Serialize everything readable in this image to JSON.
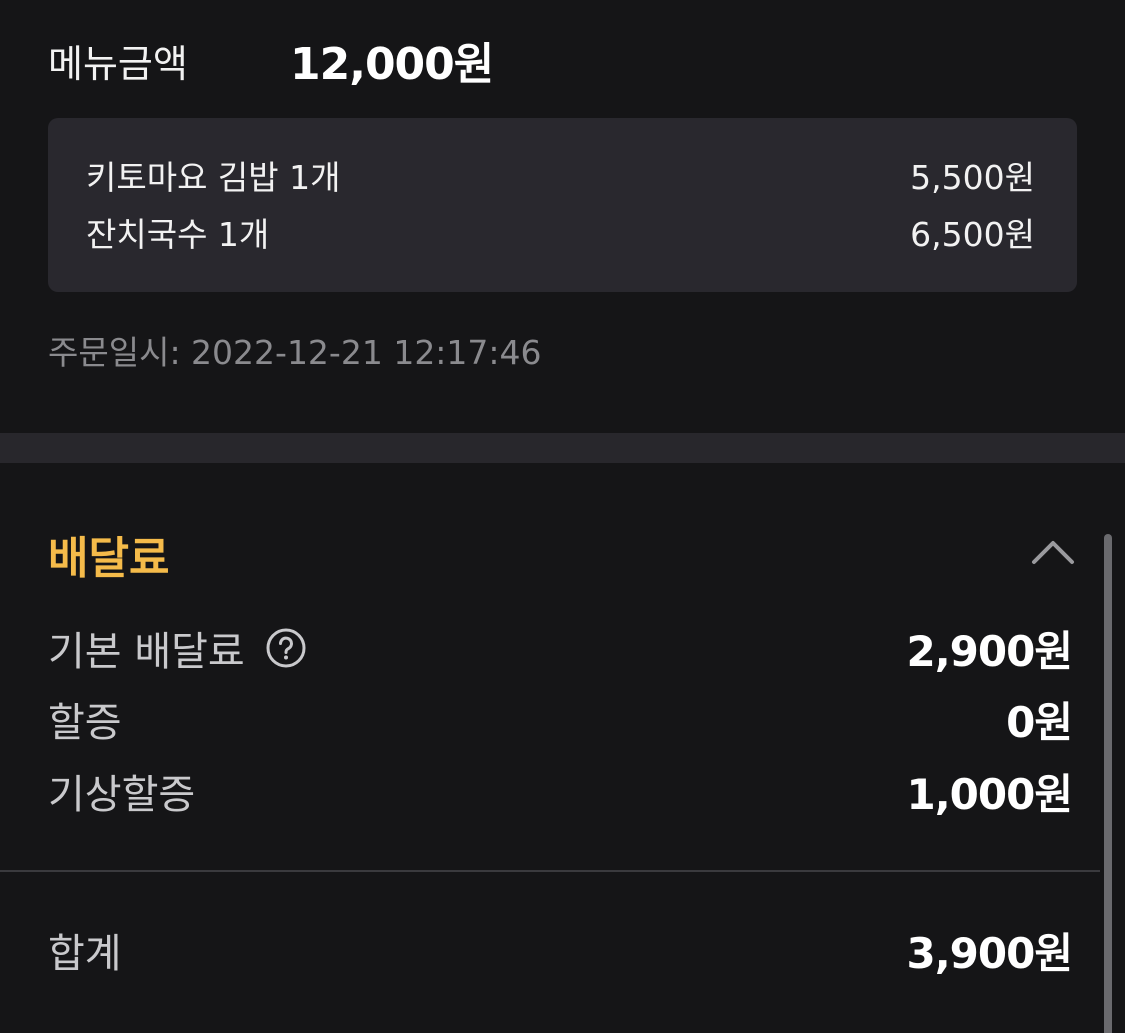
{
  "menu": {
    "label": "메뉴금액",
    "total": "12,000원",
    "items": [
      {
        "name": "키토마요 김밥 1개",
        "price": "5,500원"
      },
      {
        "name": "잔치국수 1개",
        "price": "6,500원"
      }
    ]
  },
  "order_time": "주문일시: 2022-12-21 12:17:46",
  "delivery_fee": {
    "title": "배달료",
    "rows": [
      {
        "label": "기본 배달료",
        "value": "2,900원"
      },
      {
        "label": "할증",
        "value": "0원"
      },
      {
        "label": "기상할증",
        "value": "1,000원"
      }
    ],
    "total_label": "합계",
    "total_value": "3,900원"
  },
  "icons": {
    "collapse": "chevron-up-icon",
    "help": "question-circle-icon"
  },
  "colors": {
    "background": "#151517",
    "card": "#29282e",
    "accent": "#f5bb4a",
    "muted_text": "#8a8a8e"
  }
}
